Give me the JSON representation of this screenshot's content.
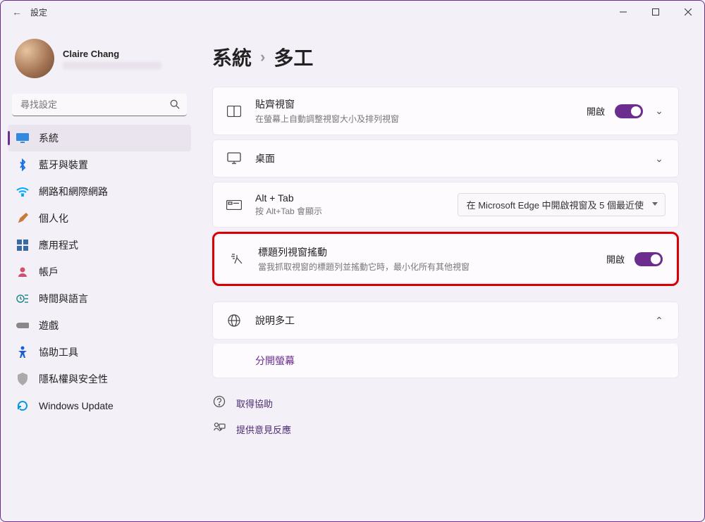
{
  "window": {
    "title": "設定"
  },
  "profile": {
    "name": "Claire Chang"
  },
  "search": {
    "placeholder": "尋找設定"
  },
  "sidebar": {
    "items": [
      {
        "label": "系統",
        "icon": "monitor",
        "color": "#1a73e8",
        "active": true
      },
      {
        "label": "藍牙與裝置",
        "icon": "bluetooth",
        "color": "#1a73e8"
      },
      {
        "label": "網路和網際網路",
        "icon": "wifi",
        "color": "#00aaff"
      },
      {
        "label": "個人化",
        "icon": "brush",
        "color": "#c77b3a"
      },
      {
        "label": "應用程式",
        "icon": "apps",
        "color": "#3a6aa5"
      },
      {
        "label": "帳戶",
        "icon": "person",
        "color": "#d05070"
      },
      {
        "label": "時間與語言",
        "icon": "clock-lang",
        "color": "#2a8a8a"
      },
      {
        "label": "遊戲",
        "icon": "gamepad",
        "color": "#888"
      },
      {
        "label": "協助工具",
        "icon": "accessibility",
        "color": "#1a5ae0"
      },
      {
        "label": "隱私權與安全性",
        "icon": "shield",
        "color": "#888"
      },
      {
        "label": "Windows Update",
        "icon": "update",
        "color": "#0099e0"
      }
    ]
  },
  "breadcrumb": {
    "root": "系統",
    "leaf": "多工"
  },
  "cards": {
    "snap": {
      "title": "貼齊視窗",
      "sub": "在螢幕上自動調整視窗大小及排列視窗",
      "state": "開啟"
    },
    "desktop": {
      "title": "桌面"
    },
    "alttab": {
      "title": "Alt + Tab",
      "sub": "按 Alt+Tab 會顯示",
      "dropdown": "在 Microsoft Edge 中開啟視窗及 5 個最近使"
    },
    "shake": {
      "title": "標題列視窗搖動",
      "sub": "當我抓取視窗的標題列並搖動它時，最小化所有其他視窗",
      "state": "開啟"
    },
    "help": {
      "title": "說明多工",
      "link": "分開螢幕"
    }
  },
  "footer": {
    "help": "取得協助",
    "feedback": "提供意見反應"
  }
}
